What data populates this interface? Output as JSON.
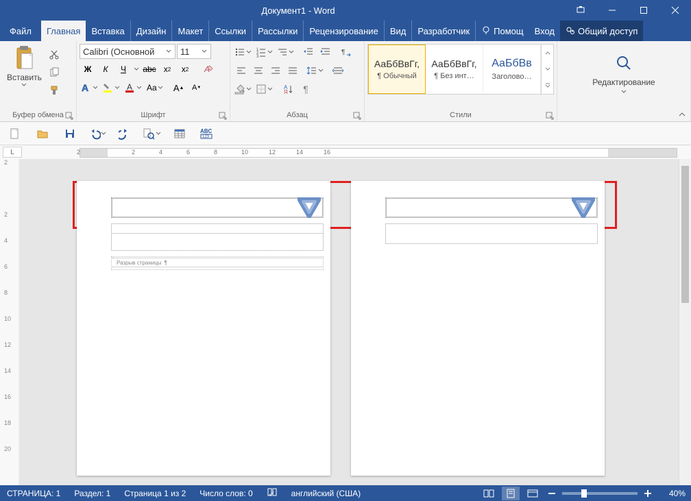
{
  "title": "Документ1 - Word",
  "tabs": {
    "file": "Файл",
    "items": [
      "Главная",
      "Вставка",
      "Дизайн",
      "Макет",
      "Ссылки",
      "Рассылки",
      "Рецензирование",
      "Вид",
      "Разработчик"
    ],
    "active_index": 0,
    "tell_me": "Помощ",
    "sign_in": "Вход",
    "share": "Общий доступ"
  },
  "ribbon": {
    "clipboard": {
      "paste": "Вставить",
      "label": "Буфер обмена"
    },
    "font": {
      "name": "Calibri (Основной",
      "size": "11",
      "label": "Шрифт",
      "bold": "Ж",
      "italic": "К",
      "underline": "Ч"
    },
    "paragraph": {
      "label": "Абзац"
    },
    "styles": {
      "label": "Стили",
      "items": [
        {
          "preview": "АаБбВвГг,",
          "name": "¶ Обычный",
          "sel": true,
          "cls": ""
        },
        {
          "preview": "АаБбВвГг,",
          "name": "¶ Без инт…",
          "sel": false,
          "cls": ""
        },
        {
          "preview": "АаБбВв",
          "name": "Заголово…",
          "sel": false,
          "cls": "heading"
        }
      ]
    },
    "editing": {
      "label": "Редактирование"
    }
  },
  "ruler": {
    "marks": [
      "2",
      "",
      "2",
      "4",
      "6",
      "8",
      "10",
      "12",
      "14",
      "16"
    ]
  },
  "vruler_marks": [
    "2",
    "",
    "2",
    "4",
    "6",
    "8",
    "10",
    "12",
    "14",
    "16",
    "18",
    "20"
  ],
  "doc": {
    "page_break_label": "Разрыв страницы"
  },
  "status": {
    "page_label": "СТРАНИЦА: 1",
    "section": "Раздел: 1",
    "page_of": "Страница 1 из 2",
    "words": "Число слов: 0",
    "language": "английский (США)",
    "zoom": "40%"
  }
}
